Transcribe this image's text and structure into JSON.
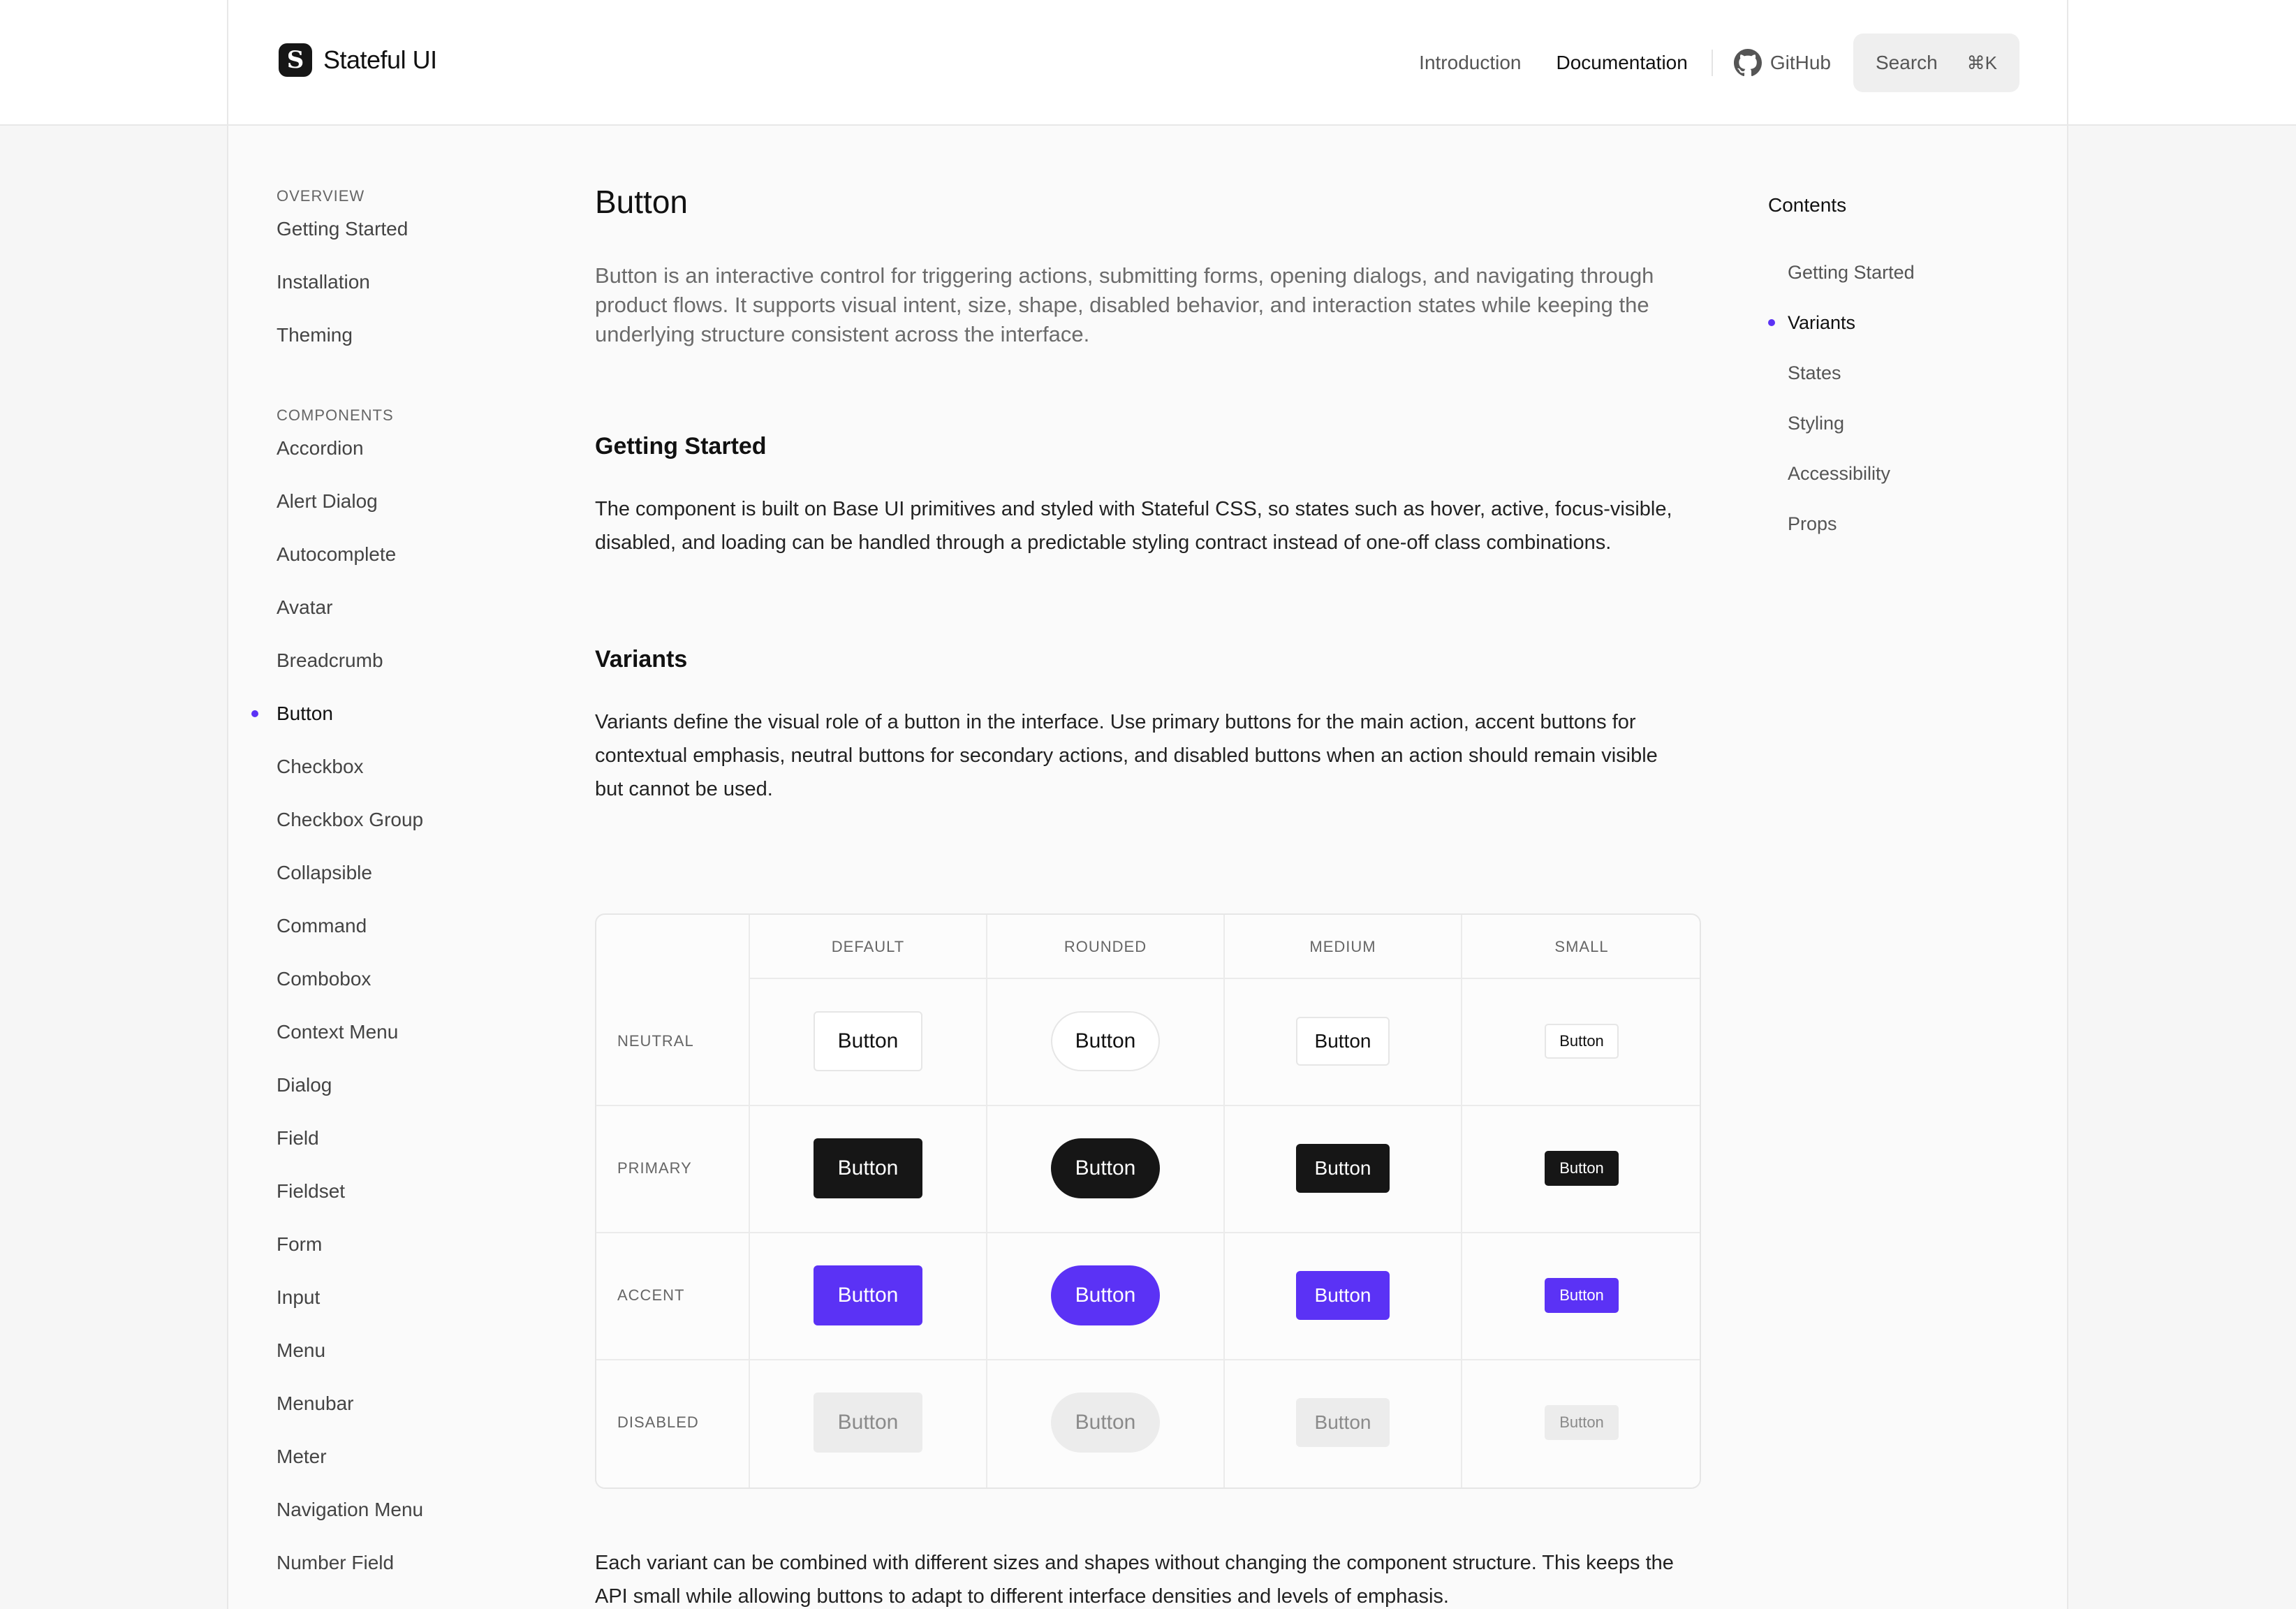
{
  "header": {
    "brand_name": "Stateful UI",
    "logo_glyph": "S",
    "nav": [
      "Introduction",
      "Documentation"
    ],
    "nav_active": "Documentation",
    "github_label": "GitHub",
    "search_label": "Search",
    "search_shortcut": "⌘K"
  },
  "sidebar": {
    "overview_heading": "OVERVIEW",
    "overview_items": [
      "Getting Started",
      "Installation",
      "Theming"
    ],
    "components_heading": "COMPONENTS",
    "component_items": [
      "Accordion",
      "Alert Dialog",
      "Autocomplete",
      "Avatar",
      "Breadcrumb",
      "Button",
      "Checkbox",
      "Checkbox Group",
      "Collapsible",
      "Command",
      "Combobox",
      "Context Menu",
      "Dialog",
      "Field",
      "Fieldset",
      "Form",
      "Input",
      "Menu",
      "Menubar",
      "Meter",
      "Navigation Menu",
      "Number Field"
    ],
    "active_item": "Button"
  },
  "main": {
    "title": "Button",
    "lead": "Button is an interactive control for triggering actions, submitting forms, opening dialogs, and navigating through product flows. It supports visual intent, size, shape, disabled behavior, and interaction states while keeping the underlying structure consistent across the interface.",
    "getting_started_title": "Getting Started",
    "getting_started_text": "The component is built on Base UI primitives and styled with Stateful CSS, so states such as hover, active, focus-visible, disabled, and loading can be handled through a predictable styling contract instead of one-off class combinations.",
    "variants_title": "Variants",
    "variants_text": "Variants define the visual role of a button in the interface. Use primary buttons for the main action, accent buttons for contextual emphasis, neutral buttons for secondary actions, and disabled buttons when an action should remain visible but cannot be used.",
    "after_text": "Each variant can be combined with different sizes and shapes without changing the component structure. This keeps the API small while allowing buttons to adapt to different interface densities and levels of emphasis."
  },
  "variant_table": {
    "columns": [
      "DEFAULT",
      "ROUNDED",
      "MEDIUM",
      "SMALL"
    ],
    "rows": [
      "NEUTRAL",
      "PRIMARY",
      "ACCENT",
      "DISABLED"
    ],
    "button_label": "Button"
  },
  "toc": {
    "title": "Contents",
    "items": [
      "Getting Started",
      "Variants",
      "States",
      "Styling",
      "Accessibility",
      "Props"
    ],
    "active_item": "Variants"
  },
  "colors": {
    "accent": "#5b32f5",
    "primary": "#161616",
    "disabled_bg": "#ececec"
  }
}
